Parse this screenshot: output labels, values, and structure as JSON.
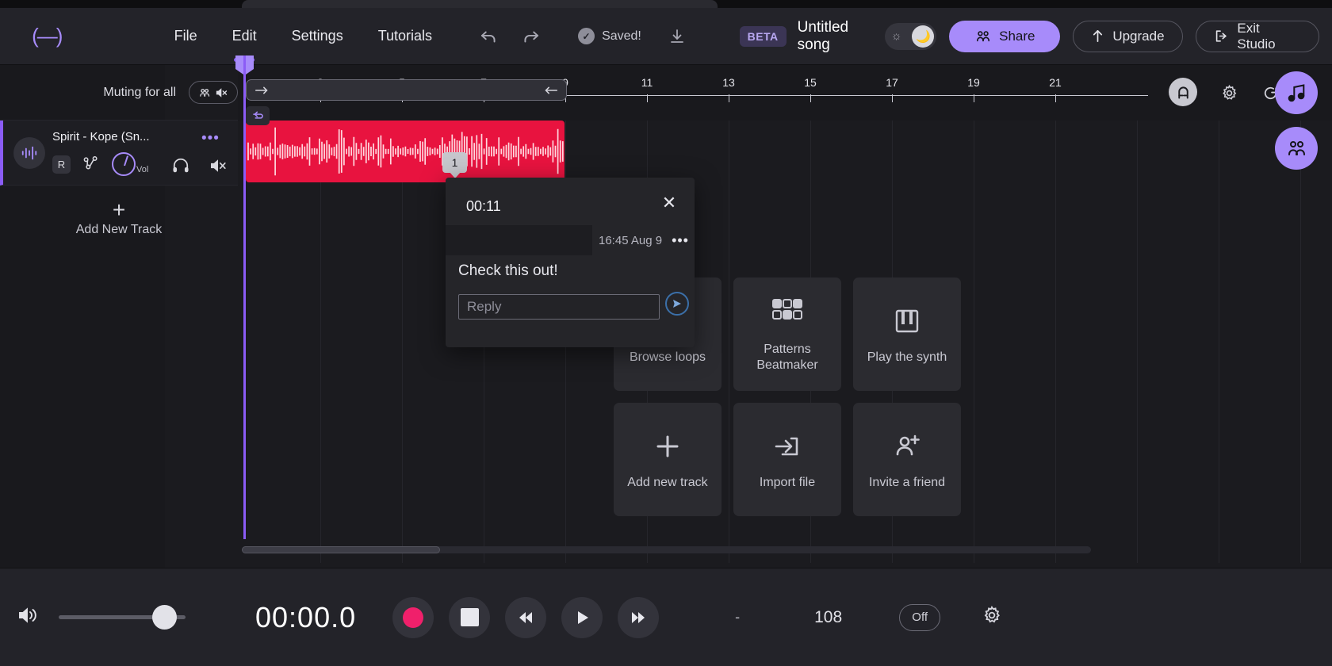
{
  "header": {
    "logo": "(—)",
    "menu": [
      {
        "label": "File",
        "active": false
      },
      {
        "label": "Edit",
        "active": true
      },
      {
        "label": "Settings",
        "active": false
      },
      {
        "label": "Tutorials",
        "active": false
      }
    ],
    "undo_icon": "undo-icon",
    "redo_icon": "redo-icon",
    "saved_label": "Saved!",
    "download_icon": "download-icon",
    "beta_badge": "BETA",
    "song_title": "Untitled song",
    "theme_sun_icon": "sun-icon",
    "theme_moon_icon": "moon-icon",
    "share_label": "Share",
    "upgrade_label": "Upgrade",
    "exit_label": "Exit Studio",
    "accent_color": "#a78bfa"
  },
  "tracks_panel": {
    "mute_all_label": "Muting for all",
    "mute_all_icon": "people-mute-icon",
    "track": {
      "name": "Spirit - Kope (Sn...",
      "avatar_icon": "waveform-icon",
      "menu_icon": "more-dots-icon",
      "record_label": "R",
      "automation_icon": "automation-icon",
      "volume_label": "Vol",
      "headphone_icon": "headphones-icon",
      "mute_icon": "speaker-mute-icon"
    },
    "add_track_label": "Add New Track",
    "add_track_icon": "plus-icon"
  },
  "timeline": {
    "ticks": [
      3,
      5,
      7,
      9,
      11,
      13,
      15,
      17,
      19,
      21
    ],
    "loop_bar": {
      "start_icon": "arrow-right-icon",
      "end_icon": "arrow-left-icon"
    },
    "snap_icon": "magnet-icon",
    "settings_icon": "gear-icon",
    "loop_icon": "loop-icon",
    "loop_chip_icon": "loop-region-icon"
  },
  "clip": {
    "color": "#e8133f",
    "marker_label": "1"
  },
  "comment_popup": {
    "time": "00:11",
    "close_icon": "close-icon",
    "author_redacted": "",
    "date": "16:45 Aug 9",
    "text": "Check this out!",
    "reply_placeholder": "Reply",
    "reply_value": "",
    "send_icon": "send-icon"
  },
  "tiles": [
    {
      "label": "Browse loops",
      "icon": "loops-icon"
    },
    {
      "label": "Patterns Beatmaker",
      "icon": "grid-pads-icon"
    },
    {
      "label": "Play the synth",
      "icon": "piano-keys-icon"
    },
    {
      "label": "Add new track",
      "icon": "plus-icon"
    },
    {
      "label": "Import file",
      "icon": "import-arrow-icon"
    },
    {
      "label": "Invite a friend",
      "icon": "person-add-icon"
    }
  ],
  "fabs": [
    {
      "icon": "music-note-icon",
      "name": "sounds-fab"
    },
    {
      "icon": "people-icon",
      "name": "collaborators-fab"
    }
  ],
  "transport": {
    "volume_icon": "volume-icon",
    "time": "00:00.0",
    "record_icon": "record-icon",
    "stop_icon": "stop-icon",
    "rewind_icon": "rewind-icon",
    "play_icon": "play-icon",
    "forward_icon": "fast-forward-icon",
    "signature": "-",
    "bpm": "108",
    "metronome_label": "Off",
    "settings_icon": "gear-icon"
  }
}
